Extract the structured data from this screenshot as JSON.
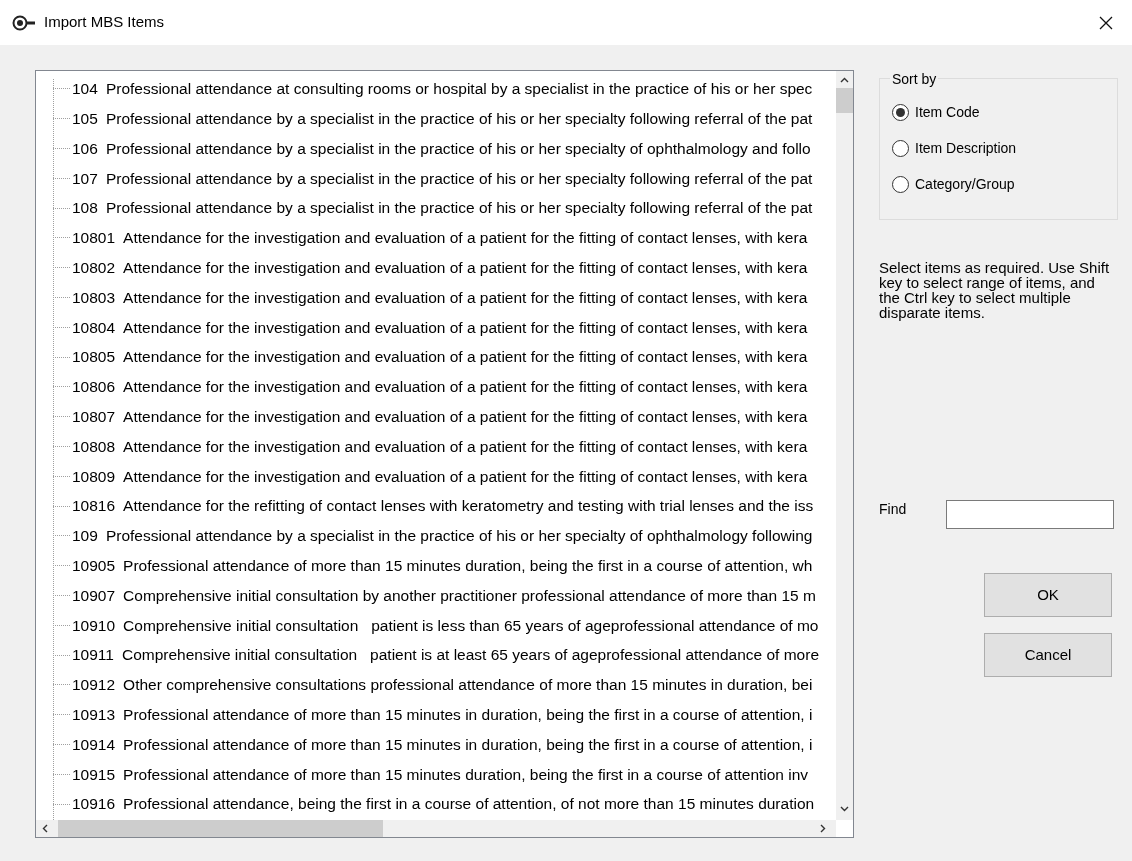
{
  "window": {
    "title": "Import MBS Items"
  },
  "items": [
    {
      "code": "104",
      "description": "Professional attendance at consulting rooms or hospital by a specialist in the practice of his or her spec"
    },
    {
      "code": "105",
      "description": "Professional attendance by a specialist in the practice of his or her specialty following referral of the pat"
    },
    {
      "code": "106",
      "description": "Professional attendance by a specialist in the practice of his or her specialty of ophthalmology and follo"
    },
    {
      "code": "107",
      "description": "Professional attendance by a specialist in the practice of his or her specialty following referral of the pat"
    },
    {
      "code": "108",
      "description": "Professional attendance by a specialist in the practice of his or her specialty following referral of the pat"
    },
    {
      "code": "10801",
      "description": "Attendance for the investigation and evaluation of a patient for the fitting of contact lenses, with kera"
    },
    {
      "code": "10802",
      "description": "Attendance for the investigation and evaluation of a patient for the fitting of contact lenses, with kera"
    },
    {
      "code": "10803",
      "description": "Attendance for the investigation and evaluation of a patient for the fitting of contact lenses, with kera"
    },
    {
      "code": "10804",
      "description": "Attendance for the investigation and evaluation of a patient for the fitting of contact lenses, with kera"
    },
    {
      "code": "10805",
      "description": "Attendance for the investigation and evaluation of a patient for the fitting of contact lenses, with kera"
    },
    {
      "code": "10806",
      "description": "Attendance for the investigation and evaluation of a patient for the fitting of contact lenses, with kera"
    },
    {
      "code": "10807",
      "description": "Attendance for the investigation and evaluation of a patient for the fitting of contact lenses, with kera"
    },
    {
      "code": "10808",
      "description": "Attendance for the investigation and evaluation of a patient for the fitting of contact lenses, with kera"
    },
    {
      "code": "10809",
      "description": "Attendance for the investigation and evaluation of a patient for the fitting of contact lenses, with kera"
    },
    {
      "code": "10816",
      "description": "Attendance for the refitting of contact lenses with keratometry and testing with trial lenses and the iss"
    },
    {
      "code": "109",
      "description": "Professional attendance by a specialist in the practice of his or her specialty of ophthalmology following"
    },
    {
      "code": "10905",
      "description": "Professional attendance of more than 15 minutes duration, being the first in a course of attention, wh"
    },
    {
      "code": "10907",
      "description": "Comprehensive initial consultation by another practitioner professional attendance of more than 15 m"
    },
    {
      "code": "10910",
      "description": "Comprehensive initial consultation   patient is less than 65 years of ageprofessional attendance of mo"
    },
    {
      "code": "10911",
      "description": "Comprehensive initial consultation   patient is at least 65 years of ageprofessional attendance of more"
    },
    {
      "code": "10912",
      "description": "Other comprehensive consultations professional attendance of more than 15 minutes in duration, bei"
    },
    {
      "code": "10913",
      "description": "Professional attendance of more than 15 minutes in duration, being the first in a course of attention, i"
    },
    {
      "code": "10914",
      "description": "Professional attendance of more than 15 minutes in duration, being the first in a course of attention, i"
    },
    {
      "code": "10915",
      "description": "Professional attendance of more than 15 minutes duration, being the first in a course of attention inv"
    },
    {
      "code": "10916",
      "description": "Professional attendance, being the first in a course of attention, of not more than 15 minutes duration"
    }
  ],
  "sort_by": {
    "title": "Sort by",
    "options": [
      {
        "label": "Item Code",
        "selected": true
      },
      {
        "label": "Item Description",
        "selected": false
      },
      {
        "label": "Category/Group",
        "selected": false
      }
    ]
  },
  "help_text": "Select items as required. Use Shift key to select range of items, and the Ctrl key to select multiple disparate items.",
  "find": {
    "label": "Find"
  },
  "buttons": [
    {
      "label": "OK"
    },
    {
      "label": "Cancel"
    }
  ]
}
